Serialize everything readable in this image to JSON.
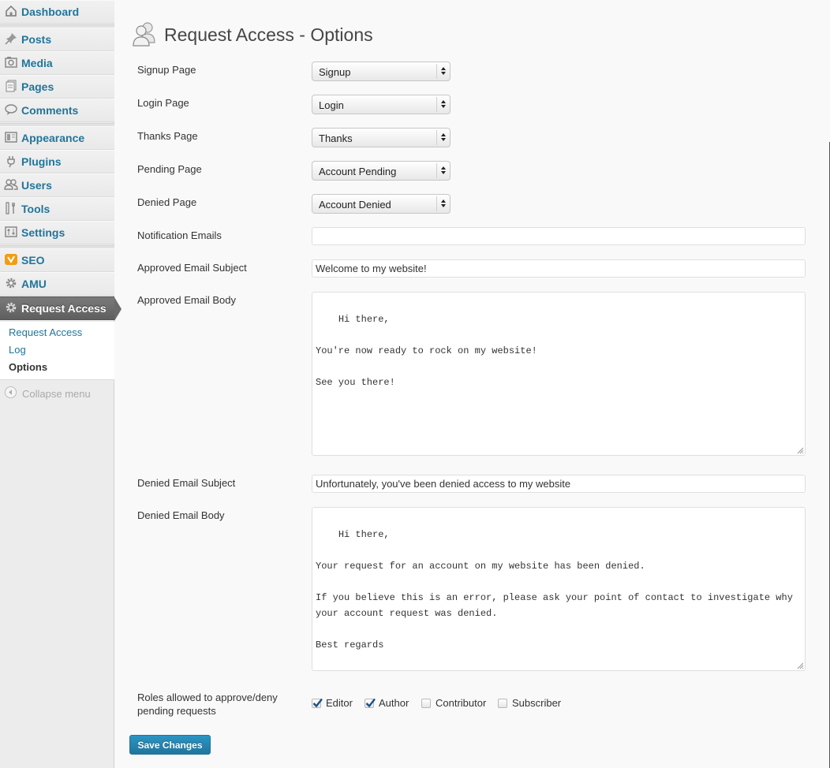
{
  "sidebar": {
    "items": [
      {
        "id": "dashboard",
        "label": "Dashboard",
        "icon": "dashboard-icon"
      },
      {
        "id": "posts",
        "label": "Posts",
        "icon": "pushpin-icon"
      },
      {
        "id": "media",
        "label": "Media",
        "icon": "media-icon"
      },
      {
        "id": "pages",
        "label": "Pages",
        "icon": "pages-icon"
      },
      {
        "id": "comments",
        "label": "Comments",
        "icon": "comment-icon"
      },
      {
        "id": "appearance",
        "label": "Appearance",
        "icon": "appearance-icon"
      },
      {
        "id": "plugins",
        "label": "Plugins",
        "icon": "plug-icon"
      },
      {
        "id": "users",
        "label": "Users",
        "icon": "users-icon"
      },
      {
        "id": "tools",
        "label": "Tools",
        "icon": "tools-icon"
      },
      {
        "id": "settings",
        "label": "Settings",
        "icon": "settings-icon"
      },
      {
        "id": "seo",
        "label": "SEO",
        "icon": "seo-icon"
      },
      {
        "id": "amu",
        "label": "AMU",
        "icon": "gear-icon"
      },
      {
        "id": "request-access",
        "label": "Request Access",
        "icon": "gear-icon"
      }
    ],
    "submenu": [
      {
        "label": "Request Access",
        "current": false
      },
      {
        "label": "Log",
        "current": false
      },
      {
        "label": "Options",
        "current": true
      }
    ],
    "collapse_label": "Collapse menu"
  },
  "page": {
    "title": "Request Access - Options",
    "title_icon": "users-icon"
  },
  "form": {
    "signup": {
      "label": "Signup Page",
      "value": "Signup"
    },
    "login": {
      "label": "Login Page",
      "value": "Login"
    },
    "thanks": {
      "label": "Thanks Page",
      "value": "Thanks"
    },
    "pending": {
      "label": "Pending Page",
      "value": "Account Pending"
    },
    "denied": {
      "label": "Denied Page",
      "value": "Account Denied"
    },
    "notification_emails": {
      "label": "Notification Emails",
      "value": ""
    },
    "approved_subject": {
      "label": "Approved Email Subject",
      "value": "Welcome to my website!"
    },
    "approved_body": {
      "label": "Approved Email Body",
      "value": "Hi there,\n\nYou're now ready to rock on my website!\n\nSee you there!"
    },
    "denied_subject": {
      "label": "Denied Email Subject",
      "value": "Unfortunately, you've been denied access to my website"
    },
    "denied_body": {
      "label": "Denied Email Body",
      "value": "Hi there,\n\nYour request for an account on my website has been denied.\n\nIf you believe this is an error, please ask your point of contact to investigate why\nyour account request was denied.\n\nBest regards"
    },
    "roles": {
      "label_line1": "Roles allowed to approve/deny",
      "label_line2": "pending requests",
      "options": [
        {
          "label": "Editor",
          "checked": true
        },
        {
          "label": "Author",
          "checked": true
        },
        {
          "label": "Contributor",
          "checked": false
        },
        {
          "label": "Subscriber",
          "checked": false
        }
      ]
    },
    "save_label": "Save Changes"
  },
  "colors": {
    "link": "#21759b",
    "active_menu": "#6a6a6a",
    "primary_button": "#21759b"
  }
}
